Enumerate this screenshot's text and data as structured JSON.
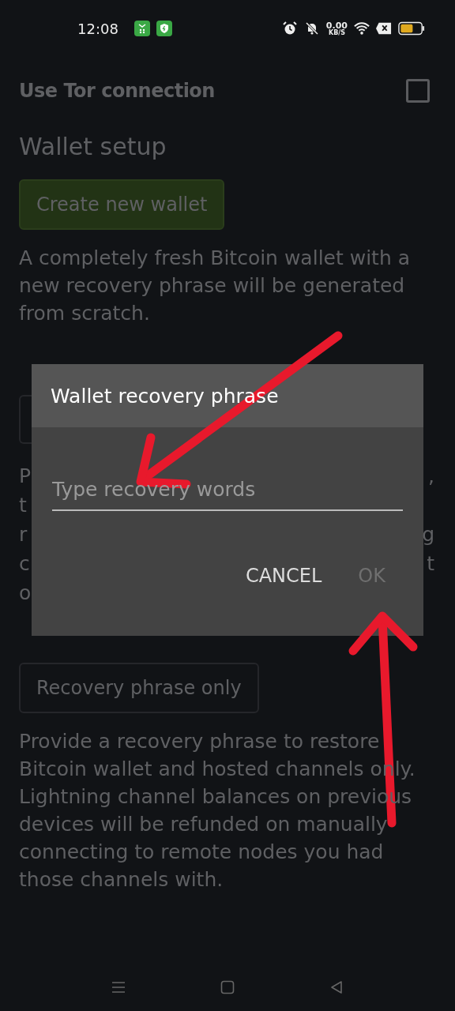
{
  "status_bar": {
    "time": "12:08",
    "speed_value": "0.00",
    "speed_unit": "KB/S"
  },
  "tor_setting": {
    "label": "Use Tor connection",
    "checked": false
  },
  "section_title": "Wallet setup",
  "create_button": {
    "label": "Create new wallet"
  },
  "create_description": "A completely fresh Bitcoin wallet with a new recovery phrase will be generated from scratch.",
  "covered_paragraph": [
    {
      "left": "P",
      "right": ","
    },
    {
      "left": "t"
    },
    {
      "left": "r",
      "right": "g"
    },
    {
      "left": "c",
      "right": "t"
    },
    {
      "left": "o"
    }
  ],
  "recovery_button": {
    "label": "Recovery phrase only"
  },
  "recovery_description": "Provide a recovery phrase to restore Bitcoin wallet and hosted channels only. Lightning channel balances on previous devices will be refunded on manually connecting to remote nodes you had those channels with.",
  "dialog": {
    "title": "Wallet recovery phrase",
    "field": {
      "placeholder": "Type recovery words"
    },
    "buttons": [
      {
        "label": "CANCEL",
        "disabled": false
      },
      {
        "label": "OK",
        "disabled": true
      }
    ]
  }
}
